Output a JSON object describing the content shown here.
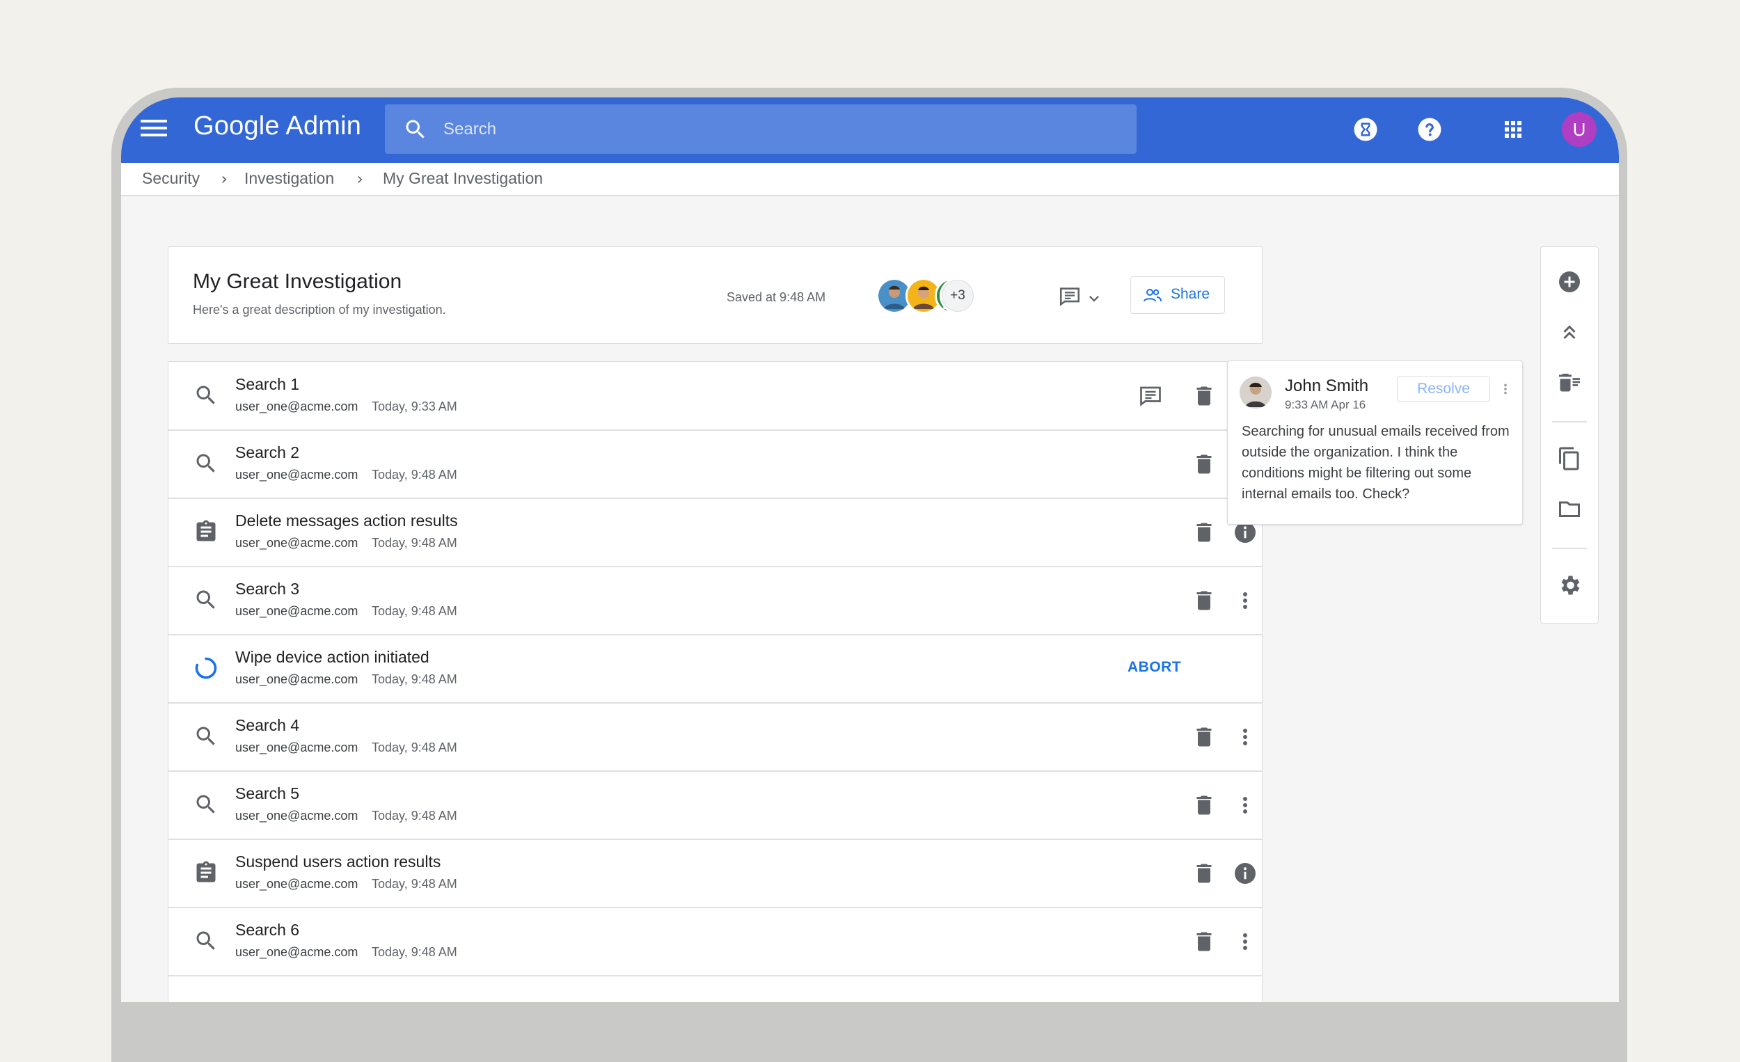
{
  "app": {
    "brand": "Google Admin",
    "avatar_initial": "U"
  },
  "search": {
    "placeholder": "Search"
  },
  "breadcrumb": {
    "items": [
      "Security",
      "Investigation",
      "My Great Investigation"
    ]
  },
  "investigation": {
    "title": "My Great Investigation",
    "description": "Here's a great description of my investigation.",
    "saved": "Saved at 9:48 AM",
    "collaborators_more": "+3",
    "share_label": "Share"
  },
  "rows": [
    {
      "title": "Search 1",
      "user": "user_one@acme.com",
      "time": "Today, 9:33 AM",
      "icon": "search-icon"
    },
    {
      "title": "Search 2",
      "user": "user_one@acme.com",
      "time": "Today, 9:48 AM",
      "icon": "search-icon"
    },
    {
      "title": "Delete messages action results",
      "user": "user_one@acme.com",
      "time": "Today, 9:48 AM",
      "icon": "clipboard-icon"
    },
    {
      "title": "Search 3",
      "user": "user_one@acme.com",
      "time": "Today, 9:48 AM",
      "icon": "search-icon"
    },
    {
      "title": "Wipe device action initiated",
      "user": "user_one@acme.com",
      "time": "Today, 9:48 AM",
      "icon": "loading-spinner-icon",
      "action": "ABORT"
    },
    {
      "title": "Search 4",
      "user": "user_one@acme.com",
      "time": "Today, 9:48 AM",
      "icon": "search-icon"
    },
    {
      "title": "Search 5",
      "user": "user_one@acme.com",
      "time": "Today, 9:48 AM",
      "icon": "search-icon"
    },
    {
      "title": "Suspend users action results",
      "user": "user_one@acme.com",
      "time": "Today, 9:48 AM",
      "icon": "clipboard-icon"
    },
    {
      "title": "Search 6",
      "user": "user_one@acme.com",
      "time": "Today, 9:48 AM",
      "icon": "search-icon"
    }
  ],
  "comment": {
    "author": "John Smith",
    "time": "9:33 AM Apr 16",
    "resolve_label": "Resolve",
    "text": "Searching for unusual emails received from outside the organization. I think the conditions might be filtering out some internal emails too. Check?"
  },
  "colors": {
    "appbar": "#3367d6",
    "accent": "#1a73e8",
    "avatar": "#b03ec2"
  }
}
